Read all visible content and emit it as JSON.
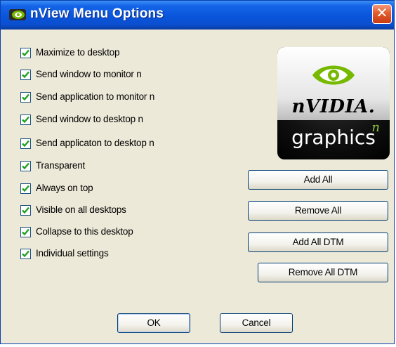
{
  "window": {
    "title": "nView Menu Options",
    "close_glyph": "✕"
  },
  "options": [
    {
      "label": "Maximize to desktop",
      "checked": true
    },
    {
      "label": "Send window to monitor n",
      "checked": true
    },
    {
      "label": "Send application to monitor n",
      "checked": true
    },
    {
      "label": "Send window to desktop n",
      "checked": true
    },
    {
      "label": "Send applicaton to desktop n",
      "checked": true
    },
    {
      "label": "Transparent",
      "checked": true
    },
    {
      "label": "Always on top",
      "checked": true
    },
    {
      "label": "Visible on all desktops",
      "checked": true
    },
    {
      "label": "Collapse to this desktop",
      "checked": true
    },
    {
      "label": "Individual settings",
      "checked": true
    }
  ],
  "logo": {
    "brand": "nVIDIA.",
    "sub": "graphics",
    "sup": "n"
  },
  "actions": {
    "add_all": "Add All",
    "remove_all": "Remove All",
    "add_all_dtm": "Add All DTM",
    "remove_all_dtm": "Remove All DTM"
  },
  "footer": {
    "ok": "OK",
    "cancel": "Cancel"
  },
  "colors": {
    "title_bar": "#0a55dc",
    "dialog_bg": "#ece9d8",
    "check": "#21a121",
    "nvidia_green": "#76b900"
  }
}
